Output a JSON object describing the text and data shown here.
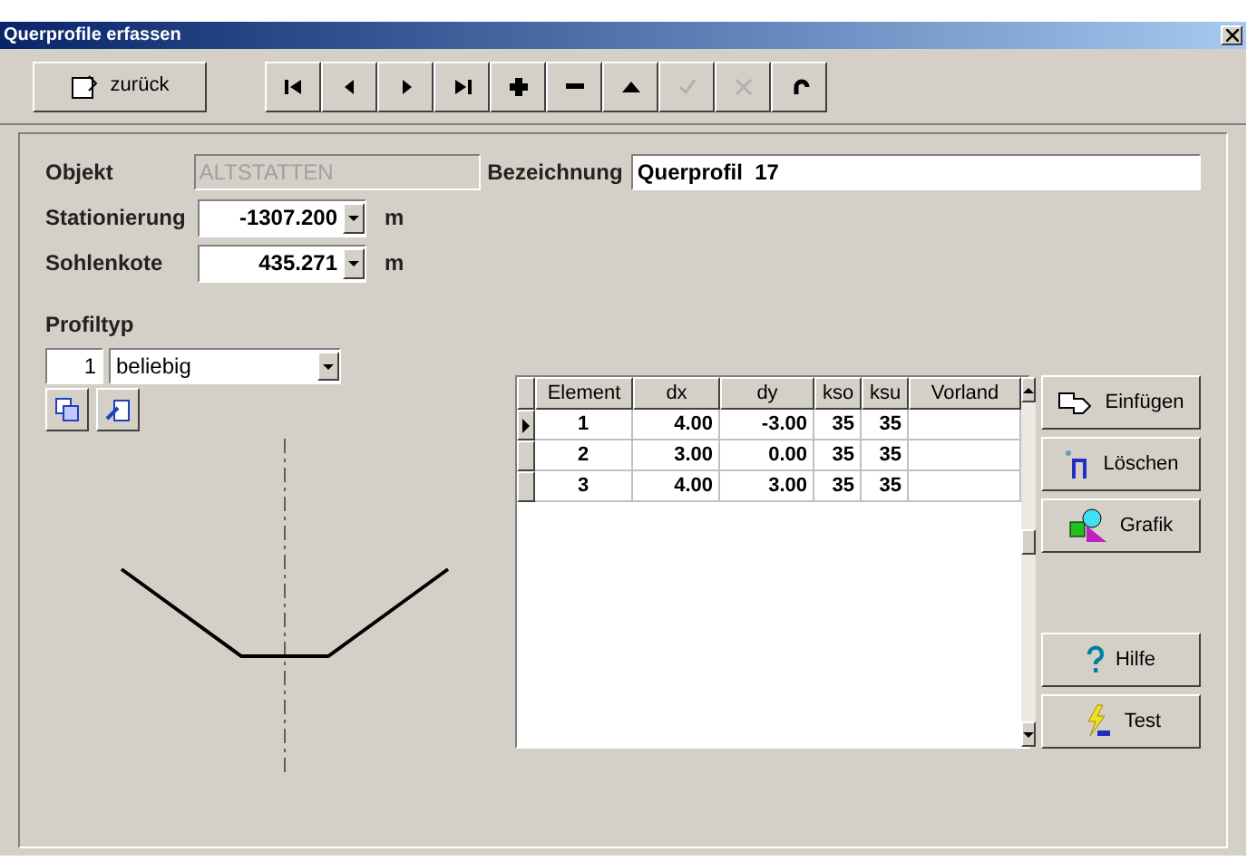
{
  "window": {
    "title": "Querprofile erfassen"
  },
  "toolbar": {
    "back_button": {
      "label": "zurück"
    },
    "tools": [
      {
        "kind": "first",
        "disabled": false
      },
      {
        "kind": "prev",
        "disabled": false
      },
      {
        "kind": "next",
        "disabled": false
      },
      {
        "kind": "last",
        "disabled": false
      },
      {
        "kind": "add",
        "disabled": false
      },
      {
        "kind": "remove",
        "disabled": false
      },
      {
        "kind": "up",
        "disabled": false
      },
      {
        "kind": "confirm",
        "disabled": true
      },
      {
        "kind": "cancel",
        "disabled": true
      },
      {
        "kind": "refresh",
        "disabled": false
      }
    ]
  },
  "form": {
    "objekt": {
      "label": "Objekt",
      "value": "ALTSTATTEN",
      "disabled": true
    },
    "bezeichnung": {
      "label": "Bezeichnung",
      "value": "Querprofil  17"
    },
    "stationierung": {
      "label": "Stationierung",
      "value": "-1307.200",
      "unit": "m"
    },
    "sohlenkote": {
      "label": "Sohlenkote",
      "value": "435.271",
      "unit": "m"
    },
    "profiltyp": {
      "label": "Profiltyp",
      "number": "1",
      "value": "beliebig"
    }
  },
  "table": {
    "columns": [
      "Element",
      "dx",
      "dy",
      "kso",
      "ksu",
      "Vorland"
    ],
    "rows": [
      {
        "selected": true,
        "cells": [
          "1",
          "4.00",
          "-3.00",
          "35",
          "35",
          ""
        ]
      },
      {
        "selected": false,
        "cells": [
          "2",
          "3.00",
          "0.00",
          "35",
          "35",
          ""
        ]
      },
      {
        "selected": false,
        "cells": [
          "3",
          "4.00",
          "3.00",
          "35",
          "35",
          ""
        ]
      }
    ]
  },
  "side_buttons": [
    {
      "kind": "insert",
      "label": "Einfügen"
    },
    {
      "kind": "delete",
      "label": "Löschen"
    },
    {
      "kind": "graphic",
      "label": "Grafik"
    },
    {
      "kind": "help",
      "label": "Hilfe"
    },
    {
      "kind": "test",
      "label": "Test"
    }
  ]
}
